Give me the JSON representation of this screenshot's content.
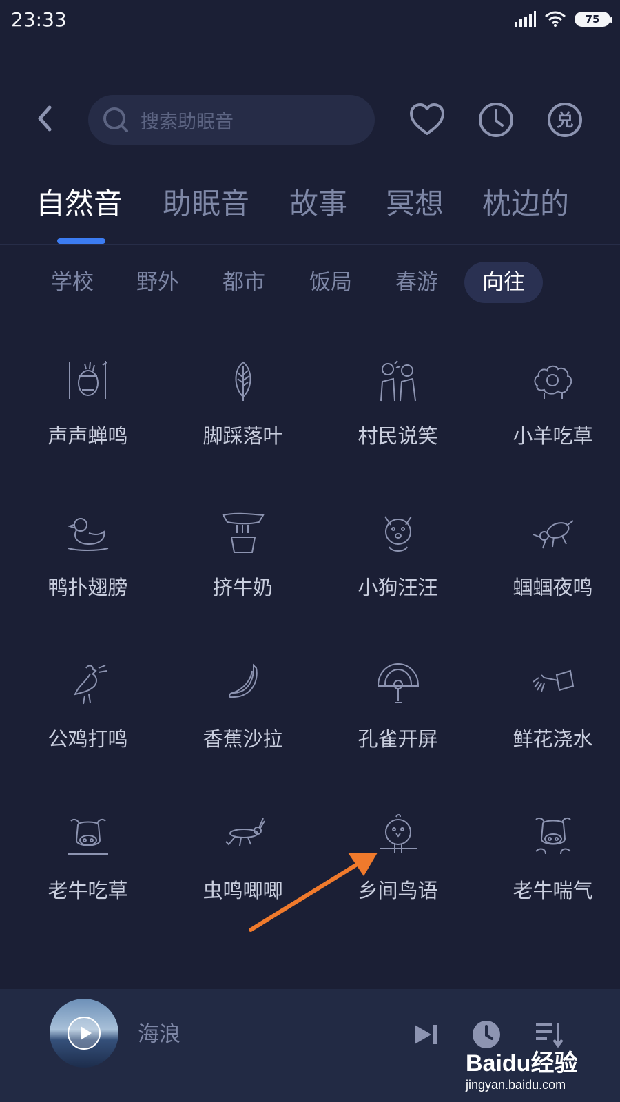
{
  "status_bar": {
    "time": "23:33",
    "battery": "75"
  },
  "search": {
    "placeholder": "搜索助眠音"
  },
  "toolbar_icons": [
    "heart-icon",
    "clock-icon",
    "redeem-icon"
  ],
  "redeem_label": "兑",
  "tabs": [
    "自然音",
    "助眠音",
    "故事",
    "冥想",
    "枕边的"
  ],
  "active_tab": "自然音",
  "subtabs": [
    "学校",
    "野外",
    "都市",
    "饭局",
    "春游",
    "向往"
  ],
  "active_subtab": "向往",
  "sounds": [
    {
      "label": "声声蝉鸣",
      "icon": "cicada-icon"
    },
    {
      "label": "脚踩落叶",
      "icon": "leaf-icon"
    },
    {
      "label": "村民说笑",
      "icon": "villagers-icon"
    },
    {
      "label": "小羊吃草",
      "icon": "sheep-icon"
    },
    {
      "label": "鸭扑翅膀",
      "icon": "duck-icon"
    },
    {
      "label": "挤牛奶",
      "icon": "milking-icon"
    },
    {
      "label": "小狗汪汪",
      "icon": "dog-icon"
    },
    {
      "label": "蝈蝈夜鸣",
      "icon": "katydid-icon"
    },
    {
      "label": "公鸡打鸣",
      "icon": "rooster-icon"
    },
    {
      "label": "香蕉沙拉",
      "icon": "banana-icon"
    },
    {
      "label": "孔雀开屏",
      "icon": "peacock-icon"
    },
    {
      "label": "鲜花浇水",
      "icon": "watering-can-icon"
    },
    {
      "label": "老牛吃草",
      "icon": "cow-icon"
    },
    {
      "label": "虫鸣唧唧",
      "icon": "grasshopper-icon"
    },
    {
      "label": "乡间鸟语",
      "icon": "bird-icon"
    },
    {
      "label": "老牛喘气",
      "icon": "cow-breathing-icon"
    }
  ],
  "player": {
    "title": "海浪"
  },
  "watermark": {
    "line1": "Baidu经验",
    "line2": "jingyan.baidu.com"
  },
  "colors": {
    "background": "#1b1f35",
    "accent": "#3c7cf2",
    "annotation_arrow": "#f07a2c"
  }
}
